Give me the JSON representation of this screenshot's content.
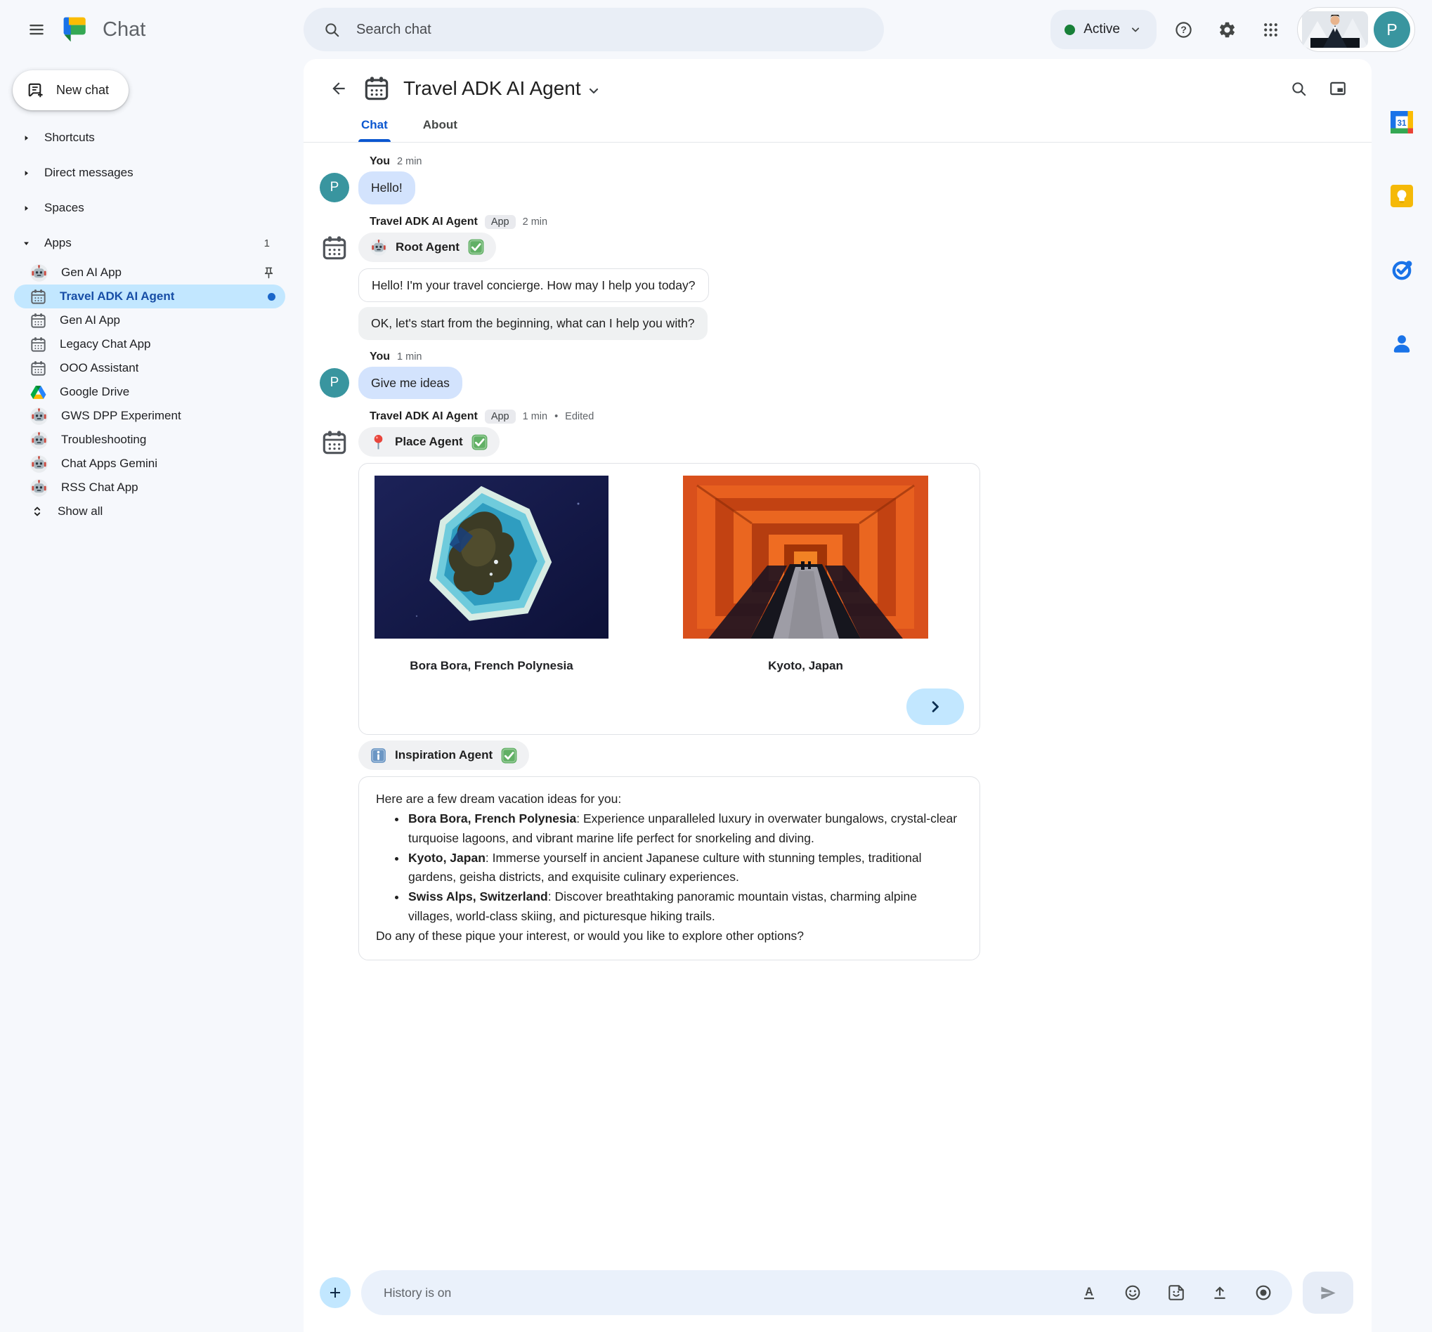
{
  "topbar": {
    "brand": "Chat",
    "search_placeholder": "Search chat",
    "status": "Active",
    "avatar_letter": "P"
  },
  "sidebar": {
    "new_chat_label": "New chat",
    "sections": [
      {
        "label": "Shortcuts"
      },
      {
        "label": "Direct messages"
      },
      {
        "label": "Spaces"
      }
    ],
    "apps_section": {
      "label": "Apps",
      "count": "1"
    },
    "apps": [
      {
        "label": "Gen AI App",
        "icon": "robot-icon",
        "pinned": true
      },
      {
        "label": "Travel ADK AI Agent",
        "icon": "calendar-app-icon",
        "selected": true,
        "unread": true
      },
      {
        "label": "Gen AI App",
        "icon": "calendar-app-icon"
      },
      {
        "label": "Legacy Chat App",
        "icon": "calendar-app-icon"
      },
      {
        "label": "OOO Assistant",
        "icon": "calendar-app-icon"
      },
      {
        "label": "Google Drive",
        "icon": "drive-icon"
      },
      {
        "label": "GWS DPP Experiment",
        "icon": "robot-icon"
      },
      {
        "label": "Troubleshooting",
        "icon": "robot-icon"
      },
      {
        "label": "Chat Apps Gemini",
        "icon": "robot-icon"
      },
      {
        "label": "RSS Chat App",
        "icon": "robot-icon"
      }
    ],
    "show_all_label": "Show all"
  },
  "chat": {
    "title": "Travel ADK AI Agent",
    "tabs": [
      {
        "label": "Chat"
      },
      {
        "label": "About"
      }
    ],
    "meta_dot": "•",
    "messages": {
      "m1": {
        "sender": "You",
        "time": "2 min",
        "text": "Hello!"
      },
      "m2": {
        "sender": "Travel ADK AI Agent",
        "badge": "App",
        "time": "2 min",
        "agent": "Root Agent",
        "bubble1": "Hello! I'm your travel concierge. How may I help you today?",
        "bubble2": "OK, let's start from the beginning, what can I help you with?"
      },
      "m3": {
        "sender": "You",
        "time": "1 min",
        "text": "Give me ideas"
      },
      "m4": {
        "sender": "Travel ADK AI Agent",
        "badge": "App",
        "time": "1 min",
        "edited": "Edited",
        "agent": "Place Agent",
        "cards": [
          {
            "caption": "Bora Bora, French Polynesia"
          },
          {
            "caption": "Kyoto, Japan"
          }
        ]
      },
      "m5": {
        "agent": "Inspiration Agent",
        "intro": "Here are a few dream vacation ideas for you:",
        "bullets": [
          {
            "title": "Bora Bora, French Polynesia",
            "text": ": Experience unparalleled luxury in overwater bungalows, crystal-clear turquoise lagoons, and vibrant marine life perfect for snorkeling and diving."
          },
          {
            "title": "Kyoto, Japan",
            "text": ": Immerse yourself in ancient Japanese culture with stunning temples, traditional gardens, geisha districts, and exquisite culinary experiences."
          },
          {
            "title": "Swiss Alps, Switzerland",
            "text": ": Discover breathtaking panoramic mountain vistas, charming alpine villages, world-class skiing, and picturesque hiking trails."
          }
        ],
        "outro": "Do any of these pique your interest, or would you like to explore other options?"
      }
    }
  },
  "composer": {
    "placeholder": "History is on"
  },
  "icons": {
    "help_glyph": "?",
    "format_glyph": "A",
    "calendar_rail_label": "31",
    "names": [
      "menu-icon",
      "chat-logo-icon",
      "search-icon",
      "help-icon",
      "settings-icon",
      "apps-grid-icon",
      "back-icon",
      "calendar-icon",
      "pin-icon",
      "robot-icon",
      "drive-icon",
      "unfold-more-icon",
      "chevron-down-icon",
      "picture-in-picture-icon",
      "check-badge-icon",
      "pushpin-red-icon",
      "info-icon",
      "chevron-right-icon",
      "plus-icon",
      "format-icon",
      "emoji-icon",
      "sticker-icon",
      "upload-icon",
      "record-icon",
      "send-icon",
      "calendar-rail-icon",
      "keep-icon",
      "tasks-icon",
      "contacts-icon"
    ]
  },
  "colors": {
    "accent_blue": "#0b57d0",
    "active_green": "#188038",
    "selected_item_bg": "#c2e7ff",
    "self_bubble": "#d3e3fd",
    "avatar_teal": "#39959f",
    "page_bg": "#f6f8fc"
  }
}
